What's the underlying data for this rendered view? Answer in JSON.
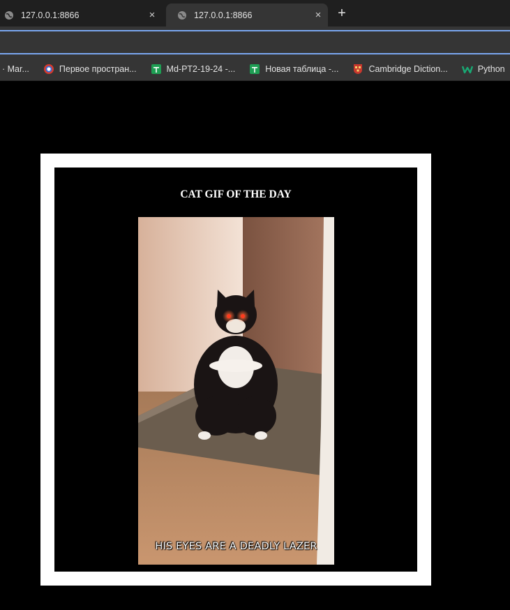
{
  "browser": {
    "tabs": [
      {
        "title": "127.0.0.1:8866",
        "close": "×",
        "active": false
      },
      {
        "title": "127.0.0.1:8866",
        "close": "×",
        "active": true
      }
    ],
    "new_tab": "+",
    "bookmarks": [
      {
        "label": "· Mar...",
        "icon": "none"
      },
      {
        "label": "Первое простран...",
        "icon": "ring-icon"
      },
      {
        "label": "Md-PT2-19-24 -...",
        "icon": "sheets-icon"
      },
      {
        "label": "Новая таблица -...",
        "icon": "sheets-icon"
      },
      {
        "label": "Cambridge Diction...",
        "icon": "cambridge-icon"
      },
      {
        "label": "Python",
        "icon": "w-icon"
      }
    ],
    "colors": {
      "accent": "#7aa7f0",
      "tabbar": "#1f1f1f",
      "toolbar": "#353535"
    }
  },
  "page": {
    "title": "CAT GIF OF THE DAY",
    "gif": {
      "caption": "HIS EYES ARE A DEADLY LAZER",
      "subject": "black-and-white cat standing upright with glowing red eyes"
    }
  }
}
